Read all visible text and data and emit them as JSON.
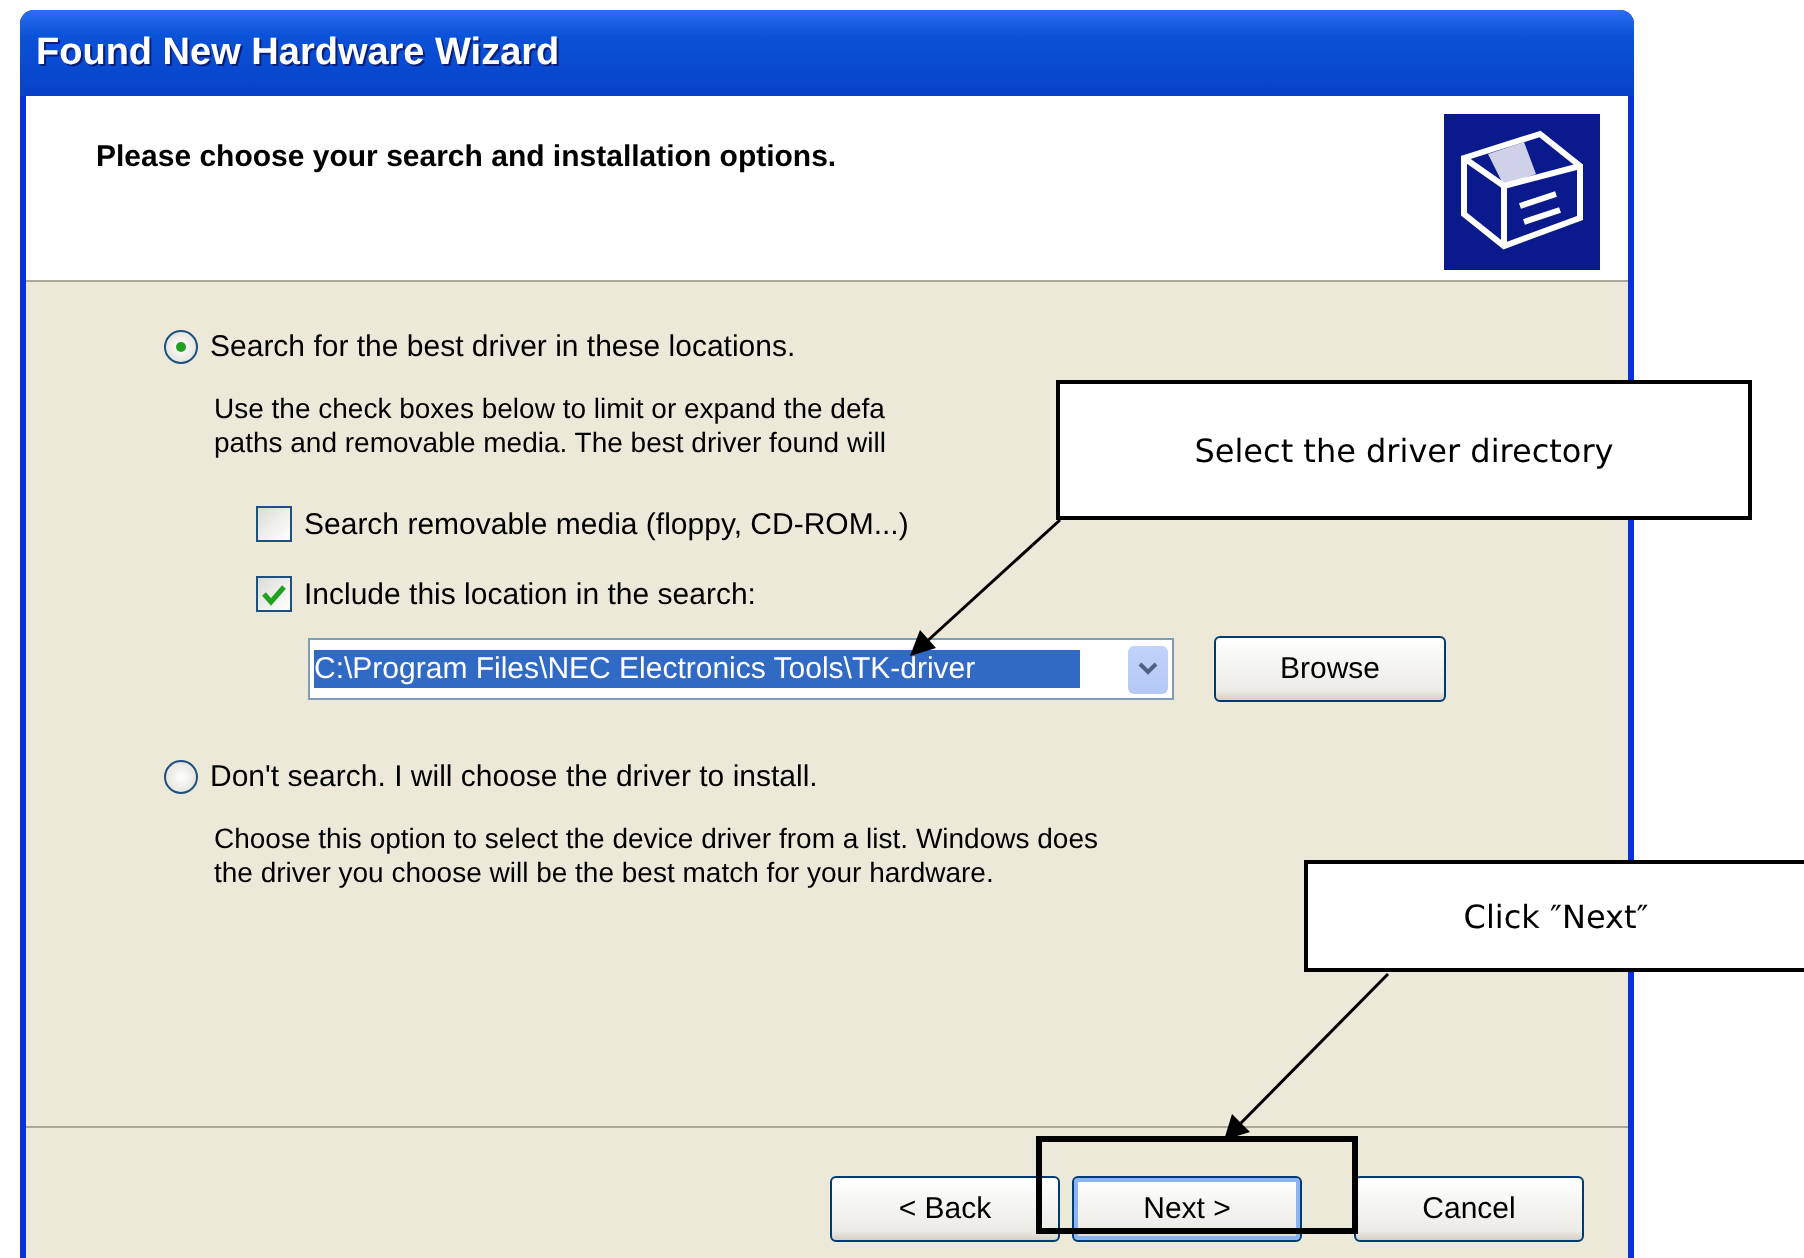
{
  "window": {
    "title": "Found New Hardware Wizard"
  },
  "header": {
    "heading": "Please choose your search and installation options."
  },
  "options": [
    {
      "label": "Search for the best driver in these locations.",
      "selected": true,
      "description": [
        "Use the check boxes below to limit or expand the defa",
        "paths and removable media. The best driver found will"
      ]
    },
    {
      "label": "Don't search. I will choose the driver to install.",
      "selected": false,
      "description": [
        "Choose this option to select the device driver from a list.  Windows does",
        "the driver you choose will be the best match for your hardware."
      ]
    }
  ],
  "checkboxes": [
    {
      "label": "Search removable media (floppy, CD-ROM...)",
      "checked": false
    },
    {
      "label": "Include this location in the search:",
      "checked": true
    }
  ],
  "location": {
    "value": "C:\\Program Files\\NEC Electronics Tools\\TK-driver",
    "browse": "Browse"
  },
  "buttons": [
    {
      "label": "< Back",
      "kind": "normal"
    },
    {
      "label": "Next >",
      "kind": "default"
    },
    {
      "label": "Cancel",
      "kind": "normal"
    }
  ],
  "callouts": [
    {
      "text": "Select the driver directory"
    },
    {
      "text": "Click ″Next″"
    }
  ]
}
